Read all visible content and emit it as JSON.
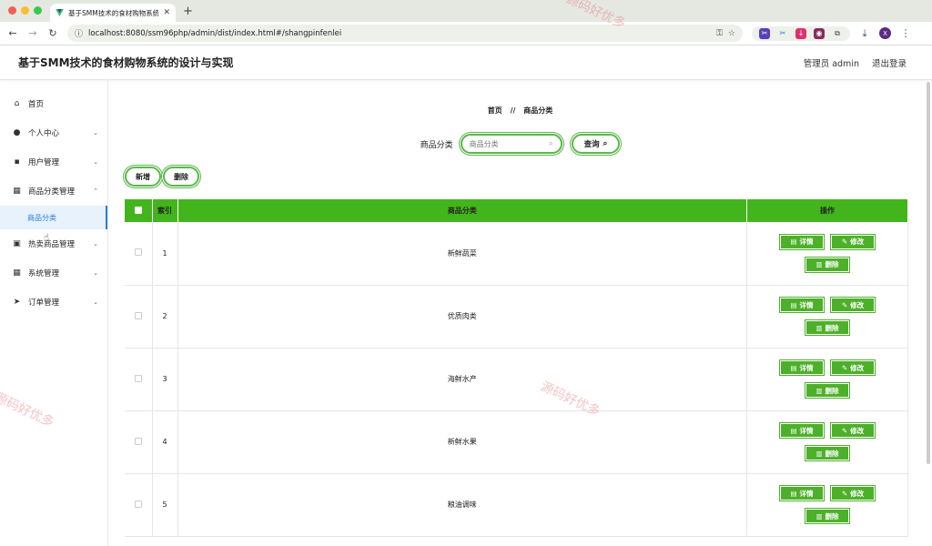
{
  "browser": {
    "tab_title": "基于SMM技术的食材购物系统...",
    "url": "localhost:8080/ssm96php/admin/dist/index.html#/shangpinfenlei",
    "new_tab": "+",
    "avatar_letter": "X"
  },
  "header": {
    "title": "基于SMM技术的食材购物系统的设计与实现",
    "user": "管理员 admin",
    "logout": "退出登录"
  },
  "sidebar": {
    "items": [
      {
        "label": "首页",
        "icon": "home-icon",
        "glyph": "⌂"
      },
      {
        "label": "个人中心",
        "icon": "user-icon",
        "glyph": "●"
      },
      {
        "label": "用户管理",
        "icon": "folder-icon",
        "glyph": "▪"
      },
      {
        "label": "商品分类管理",
        "icon": "grid-icon",
        "glyph": "▦"
      },
      {
        "label": "热卖商品管理",
        "icon": "box-icon",
        "glyph": "▣"
      },
      {
        "label": "系统管理",
        "icon": "grid-icon",
        "glyph": "▦"
      },
      {
        "label": "订单管理",
        "icon": "send-icon",
        "glyph": "➤"
      }
    ],
    "active_sub": "商品分类"
  },
  "main": {
    "breadcrumb": {
      "home": "首页",
      "sep": "//",
      "current": "商品分类"
    },
    "search": {
      "label": "商品分类",
      "placeholder": "商品分类",
      "button": "查询"
    },
    "actions": {
      "add": "新增",
      "delete": "删除"
    },
    "table": {
      "headers": {
        "index": "索引",
        "category": "商品分类",
        "ops": "操作"
      },
      "rows": [
        {
          "index": "1",
          "name": "新鲜蔬菜"
        },
        {
          "index": "2",
          "name": "优质肉类"
        },
        {
          "index": "3",
          "name": "海鲜水产"
        },
        {
          "index": "4",
          "name": "新鲜水果"
        },
        {
          "index": "5",
          "name": "粮油调味"
        }
      ],
      "op_labels": {
        "detail": "详情",
        "edit": "修改",
        "delete": "删除"
      }
    }
  },
  "watermark": "源码好优多",
  "colors": {
    "accent": "#43b51c",
    "link": "#2a7fd9"
  }
}
